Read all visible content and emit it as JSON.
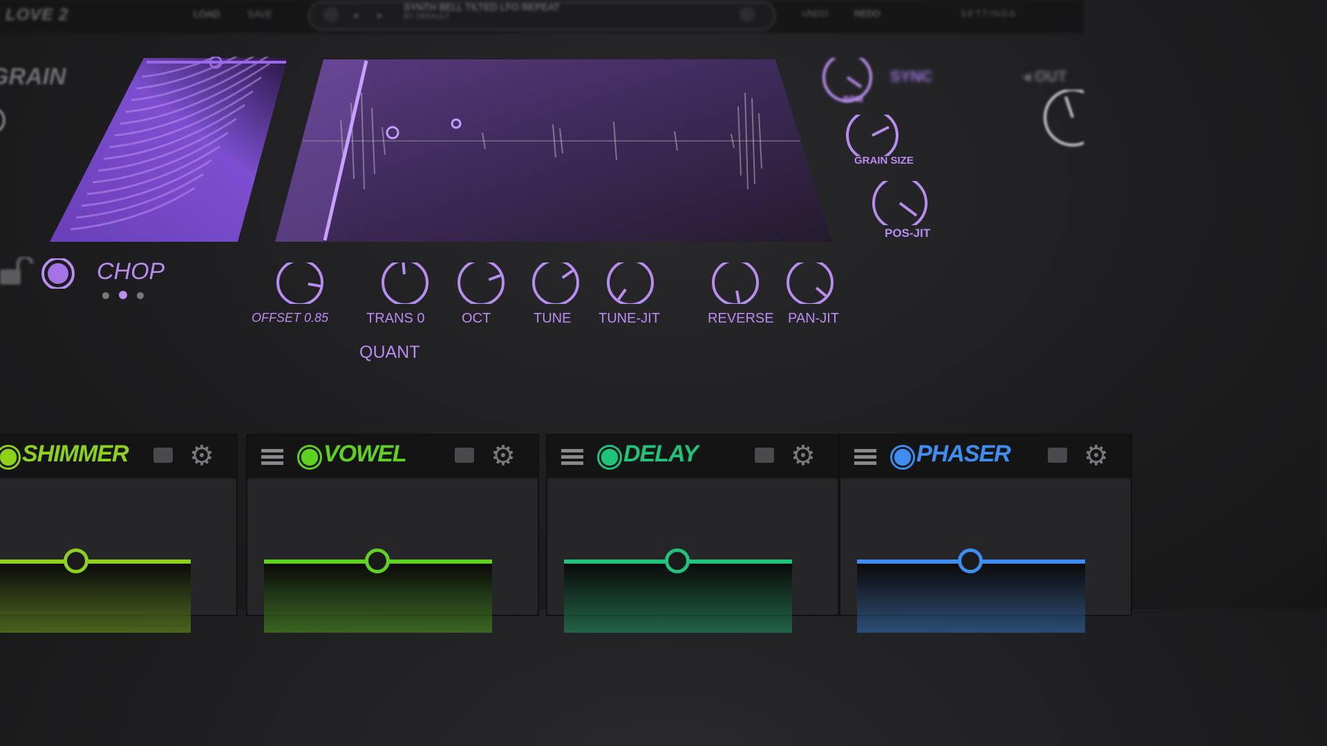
{
  "header": {
    "brand": "LOVE 2",
    "tab_a": "LOAD",
    "tab_b": "SAVE",
    "preset_line1": "SYNTH BELL TILTED LFO REPEAT",
    "preset_line2": "BY DEFAULT",
    "right_a": "UNDO",
    "right_b": "REDO",
    "right_c": "SETTINGS"
  },
  "section": {
    "title": "GRAIN",
    "mode": "CHOP"
  },
  "right_knobs": {
    "bpm": "BPM",
    "sync": "SYNC",
    "grain_size": "GRAIN SIZE",
    "pos_jit": "POS-JIT",
    "out": "OUT"
  },
  "knobs": [
    {
      "label": "OFFSET 0.85"
    },
    {
      "label": "TRANS 0"
    },
    {
      "label": "OCT"
    },
    {
      "label": "TUNE"
    },
    {
      "label": "TUNE-JIT"
    },
    {
      "label": "REVERSE"
    },
    {
      "label": "PAN-JIT"
    }
  ],
  "quant_label": "QUANT",
  "fx": [
    {
      "name": "SHIMMER",
      "color": "#8ed11a"
    },
    {
      "name": "VOWEL",
      "color": "#5fd11f"
    },
    {
      "name": "DELAY",
      "color": "#1ec47a"
    },
    {
      "name": "PHASER",
      "color": "#3d8ef0"
    }
  ],
  "colors": {
    "accent": "#b98cf0",
    "panel": "#1f1f21"
  }
}
